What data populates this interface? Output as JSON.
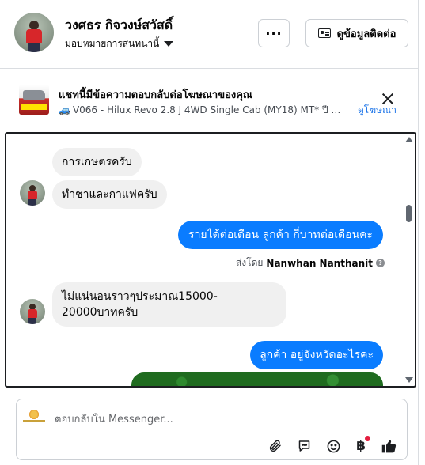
{
  "header": {
    "name": "วงศธร กิจวงษ์สวัสดิ์",
    "assign_label": "มอบหมายการสนทนานี้",
    "more_label": "···",
    "contact_label": "ดูข้อมูลติดต่อ"
  },
  "ad": {
    "title": "แชทนี้มีข้อความตอบกลับต่อโฆษณาของคุณ",
    "subtitle_icon": "🚙",
    "subtitle": "V066 - Hilux Revo 2.8 J 4WD Single Cab (MY18) MT* ปี 2018 ...",
    "view_ad_label": "ดูโฆษณา"
  },
  "messages": [
    {
      "from": "customer",
      "text": "การเกษตรครับ"
    },
    {
      "from": "customer",
      "text": "ทำชาและกาแฟครับ"
    },
    {
      "from": "page",
      "text": "รายได้ต่อเดือน ลูกค้า กี่บาทต่อเดือนคะ"
    },
    {
      "from": "customer",
      "text_line1": "ไม่แน่นอนราวๆประมาณ15000-",
      "text_line2": "20000บาทครับ"
    },
    {
      "from": "page",
      "text": "ลูกค้า   อยู่จังหวัดอะไรคะ"
    }
  ],
  "sent_by": {
    "prefix": "ส่งโดย",
    "name": "Nanwhan Nanthanit"
  },
  "composer": {
    "placeholder": "ตอบกลับใน Messenger...",
    "tools": [
      "paperclip-icon",
      "speech-bubble-icon",
      "smiley-icon",
      "baht-icon",
      "thumbs-up-icon"
    ]
  },
  "colors": {
    "accent": "#0a7cff",
    "incoming_bg": "#f0f0f0",
    "notification": "#e41e3f",
    "link": "#1a73e8"
  }
}
